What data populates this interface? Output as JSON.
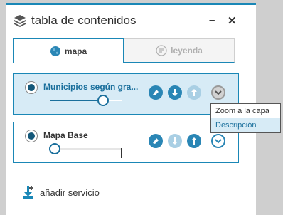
{
  "panel": {
    "title": "tabla de contenidos"
  },
  "tabs": [
    {
      "label": "mapa",
      "active": true
    },
    {
      "label": "leyenda",
      "active": false
    }
  ],
  "layers": [
    {
      "name": "Municipios según gra...",
      "selected": true,
      "opacity": 0.75
    },
    {
      "name": "Mapa Base",
      "selected": true,
      "opacity": 0.0
    }
  ],
  "context_menu": {
    "items": [
      "Zoom a la capa",
      "Descripción"
    ]
  },
  "add_service": {
    "label": "añadir servicio"
  },
  "colors": {
    "accent": "#1a87b6",
    "selected_row": "#d7ebf6"
  }
}
